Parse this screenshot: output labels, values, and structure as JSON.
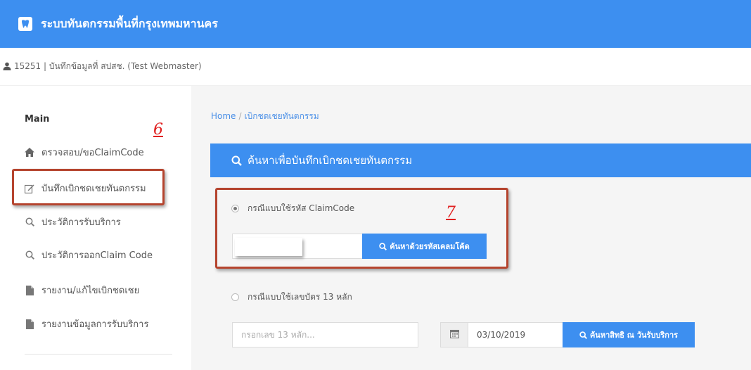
{
  "header": {
    "title": "ระบบทันตกรรมพื้นที่กรุงเทพมหานคร",
    "logo_icon": "tooth-logo-icon"
  },
  "user": {
    "label": "15251 | บันทึกข้อมูลที่ สปสช. (Test Webmaster)",
    "icon": "user-icon"
  },
  "sidebar": {
    "heading": "Main",
    "items": [
      {
        "label": "ตรวจสอบ/ขอClaimCode",
        "icon": "home-icon"
      },
      {
        "label": "บันทึกเบิกชดเชยทันตกรรม",
        "icon": "edit-icon"
      },
      {
        "label": "ประวัติการรับบริการ",
        "icon": "search-icon"
      },
      {
        "label": "ประวัติการออกClaim Code",
        "icon": "search-icon"
      },
      {
        "label": "รายงาน/แก้ไขเบิกชดเชย",
        "icon": "file-icon"
      },
      {
        "label": "รายงานข้อมูลการรับบริการ",
        "icon": "file-icon"
      }
    ]
  },
  "annotations": {
    "sidebar_number": "6",
    "form_number": "7"
  },
  "breadcrumb": {
    "home": "Home",
    "separator": "/",
    "current": "เบิกชดเชยทันตกรรม"
  },
  "panel": {
    "title": "ค้นหาเพื่อบันทึกเบิกชดเชยทันตกรรม"
  },
  "form": {
    "claim_option": {
      "label": "กรณีแบบใช้รหัส ClaimCode",
      "selected": true
    },
    "claim_input": {
      "value": ""
    },
    "claim_button": "ค้นหาด้วยรหัสเคลมโค้ด",
    "id_option": {
      "label": "กรณีแบบใช้เลขบัตร 13 หลัก",
      "selected": false
    },
    "id_input": {
      "placeholder": "กรอกเลข 13 หลัก..."
    },
    "date_input": {
      "value": "03/10/2019"
    },
    "id_button": "ค้นหาสิทธิ ณ วันรับบริการ"
  },
  "colors": {
    "primary": "#3d8ff0",
    "annotation_box": "#b5442e",
    "annotation_number": "#e02020"
  }
}
